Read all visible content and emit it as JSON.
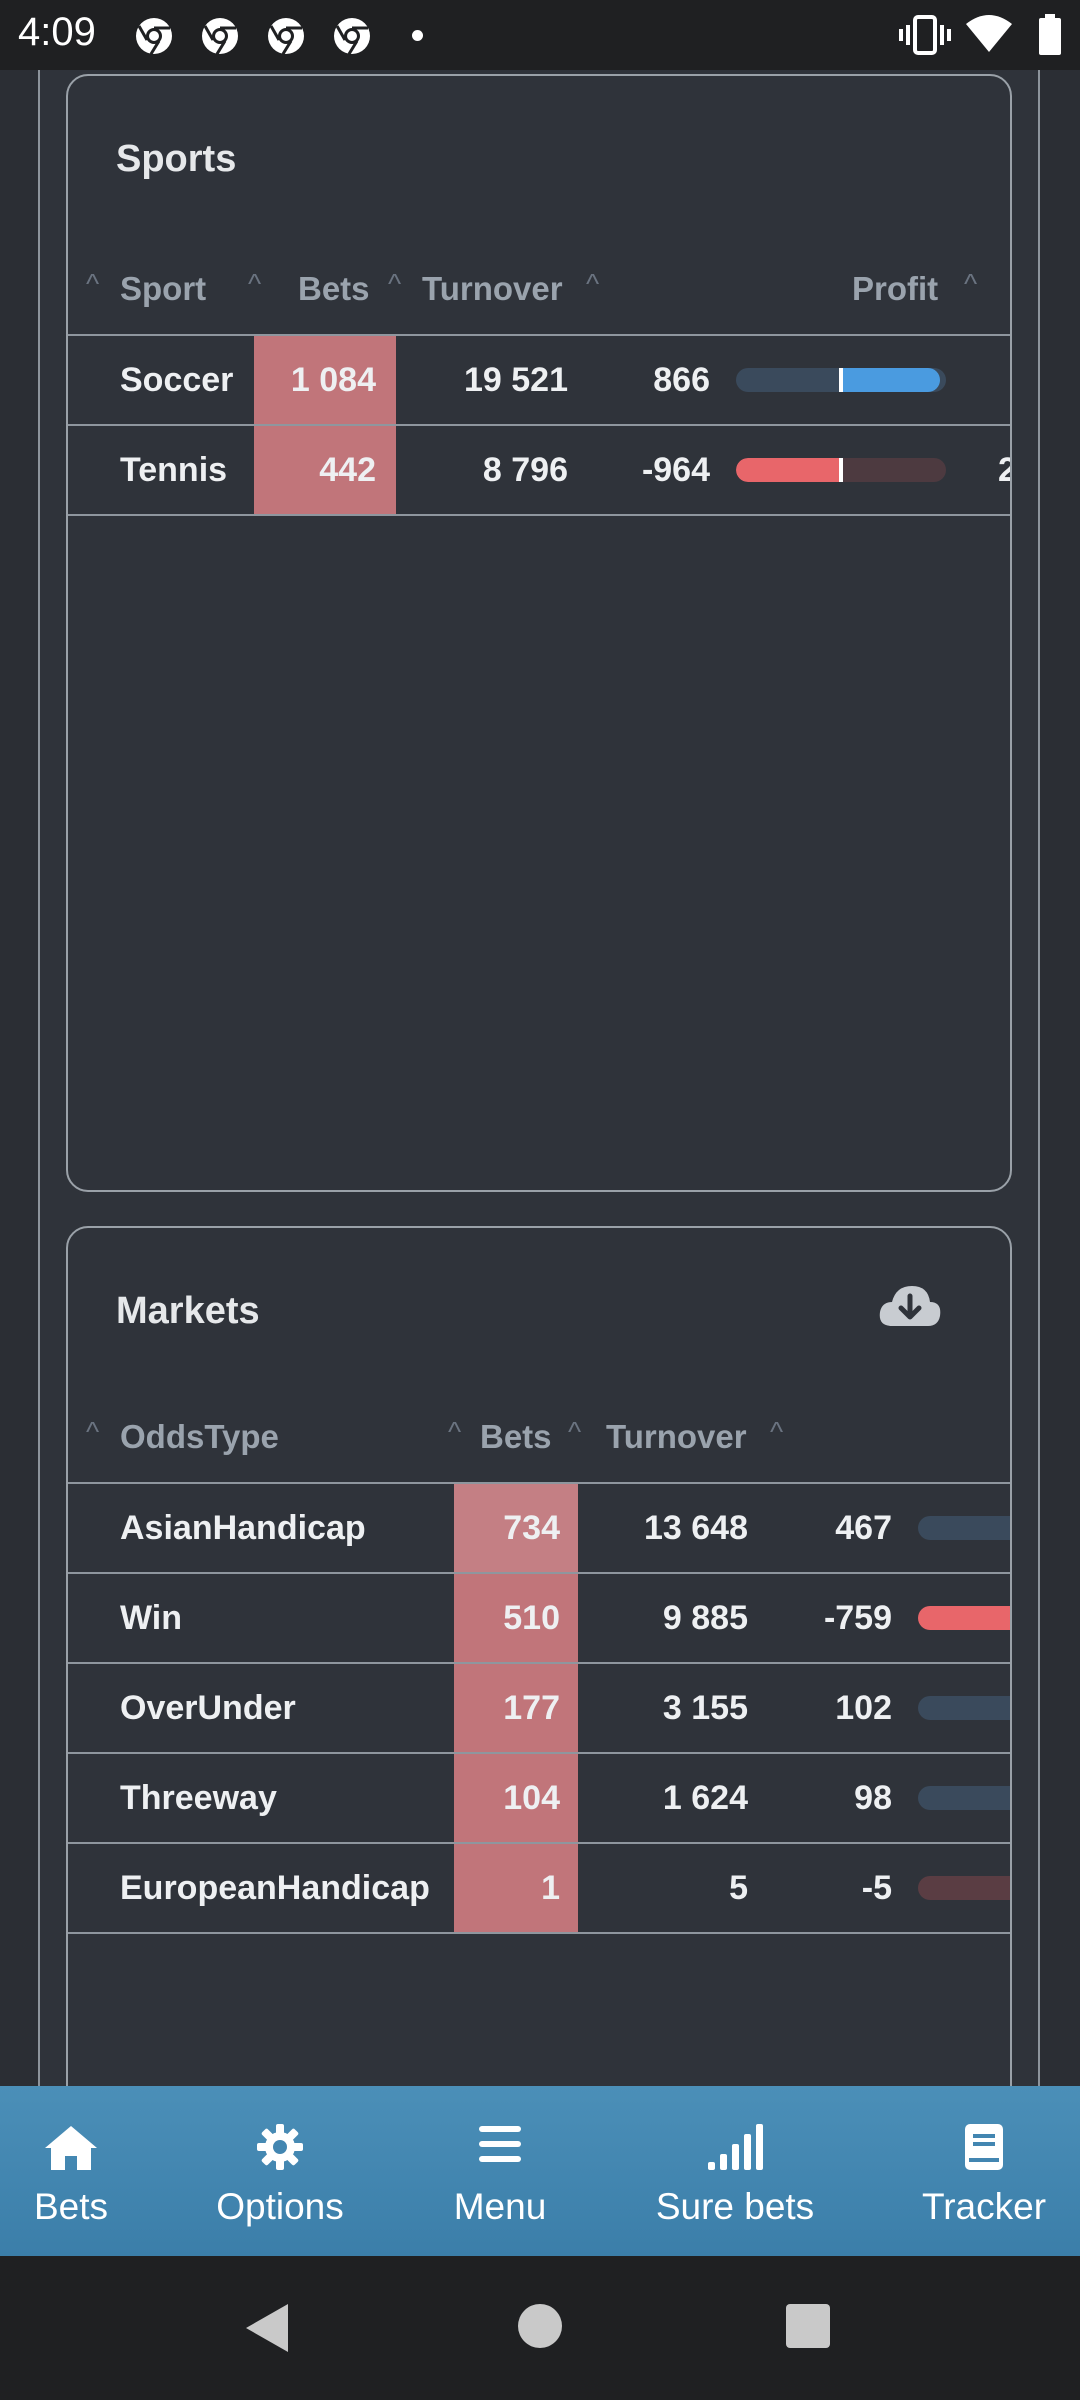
{
  "status_bar": {
    "time": "4:09",
    "icons": [
      "chrome-icon",
      "chrome-icon",
      "chrome-icon",
      "chrome-icon",
      "dot-icon",
      "vibrate-icon",
      "wifi-icon",
      "battery-icon"
    ]
  },
  "sports": {
    "title": "Sports",
    "columns": {
      "sport": "Sport",
      "bets": "Bets",
      "turnover": "Turnover",
      "profit": "Profit"
    },
    "rows": [
      {
        "sport": "Soccer",
        "bets": "1 084",
        "turnover": "19 521",
        "profit": "866",
        "bar_fraction": 0.47
      },
      {
        "sport": "Tennis",
        "bets": "442",
        "turnover": "8 796",
        "profit": "-964",
        "bar_fraction": -0.5,
        "extra": "2"
      }
    ]
  },
  "markets": {
    "title": "Markets",
    "download_icon": "cloud-download-icon",
    "columns": {
      "odds_type": "OddsType",
      "bets": "Bets",
      "turnover": "Turnover"
    },
    "rows": [
      {
        "odds_type": "AsianHandicap",
        "bets": "734",
        "turnover": "13 648",
        "profit": "467"
      },
      {
        "odds_type": "Win",
        "bets": "510",
        "turnover": "9 885",
        "profit": "-759"
      },
      {
        "odds_type": "OverUnder",
        "bets": "177",
        "turnover": "3 155",
        "profit": "102"
      },
      {
        "odds_type": "Threeway",
        "bets": "104",
        "turnover": "1 624",
        "profit": "98"
      },
      {
        "odds_type": "EuropeanHandicap",
        "bets": "1",
        "turnover": "5",
        "profit": "-5"
      }
    ]
  },
  "bottom_nav": {
    "items": [
      {
        "label": "Bets",
        "icon": "home-icon"
      },
      {
        "label": "Options",
        "icon": "gear-icon"
      },
      {
        "label": "Menu",
        "icon": "menu-icon"
      },
      {
        "label": "Sure bets",
        "icon": "signal-bars-icon"
      },
      {
        "label": "Tracker",
        "icon": "book-icon"
      }
    ]
  },
  "colors": {
    "bets_highlight": "#c1757a",
    "positive_bar": "#4a9be0",
    "negative_bar": "#e8666a",
    "nav_bg": "#4386b1"
  }
}
